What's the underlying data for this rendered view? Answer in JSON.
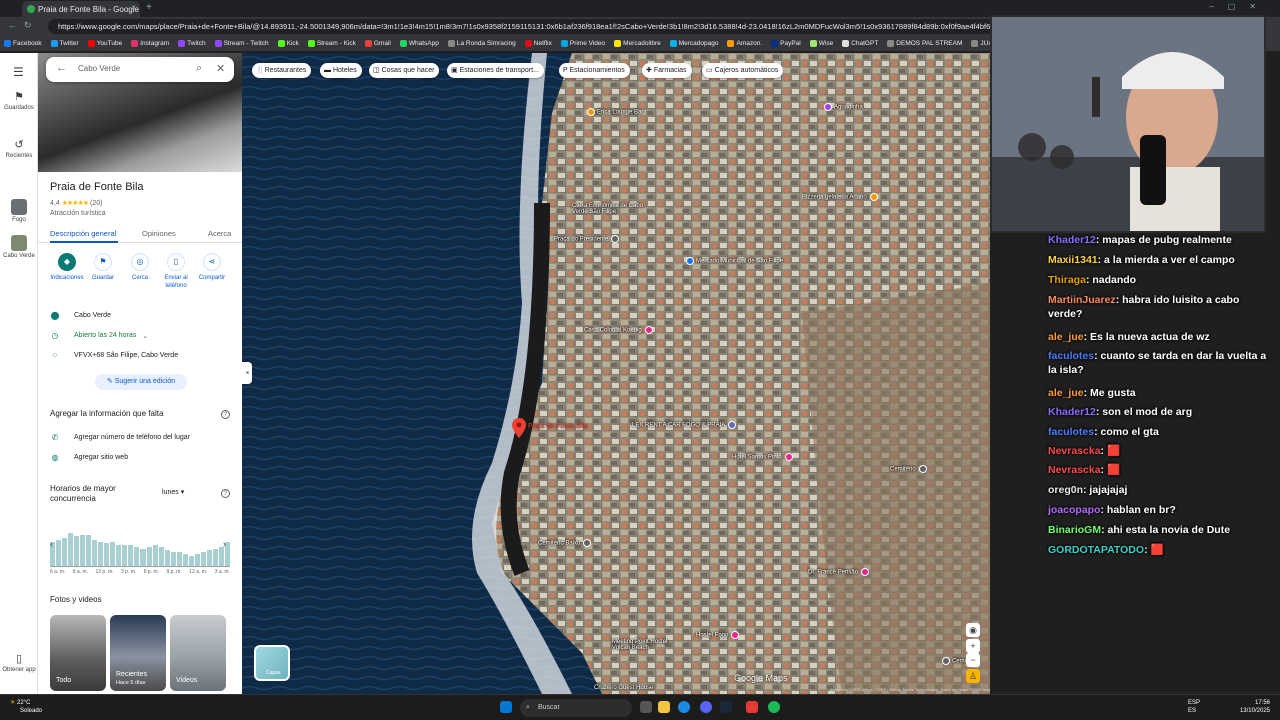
{
  "browser": {
    "tab_title": "Praia de Fonte Bila - Google Map",
    "url": "https://www.google.com/maps/place/Praia+de+Fonte+Bila/@14.893911,-24.5001349,906m/data=!3m1!1e3!4m15!1m8!3m7!1s0x9358f2159115131:0x6b1af236f918ea1f!2sCabo+Verde!3b1!8m2!3d16.5388!4d-23.0418!16zL2m0MDFucWol3m5!1s0x93617889f84d89b:0xf0f9ae4f4bf66acd!8m2!3d14.8931194",
    "bookmarks": [
      {
        "label": "Facebook",
        "color": "#1877f2"
      },
      {
        "label": "Twitter",
        "color": "#1d9bf0"
      },
      {
        "label": "YouTube",
        "color": "#ff0000"
      },
      {
        "label": "Instagram",
        "color": "#e1306c"
      },
      {
        "label": "Twitch",
        "color": "#9146ff"
      },
      {
        "label": "Stream - Twitch",
        "color": "#9146ff"
      },
      {
        "label": "Kick",
        "color": "#53fc18"
      },
      {
        "label": "Stream - Kick",
        "color": "#53fc18"
      },
      {
        "label": "Gmail",
        "color": "#ea4335"
      },
      {
        "label": "WhatsApp",
        "color": "#25d366"
      },
      {
        "label": "La Ronda Simracing",
        "color": "#888888"
      },
      {
        "label": "Netflix",
        "color": "#e50914"
      },
      {
        "label": "Prime Video",
        "color": "#00a8e1"
      },
      {
        "label": "Mercadolibre",
        "color": "#ffe600"
      },
      {
        "label": "Mercadopago",
        "color": "#00b1ea"
      },
      {
        "label": "Amazon.",
        "color": "#ff9900"
      },
      {
        "label": "PayPal",
        "color": "#003087"
      },
      {
        "label": "Wise",
        "color": "#9fe870"
      },
      {
        "label": "ChatGPT",
        "color": "#dddddd"
      },
      {
        "label": "DEMOS PAL STREAM",
        "color": "#888888"
      },
      {
        "label": "JUAN TURRITO",
        "color": "#888888"
      }
    ]
  },
  "rail": {
    "saved": "Guardados",
    "recent": "Recientes",
    "fogo": "Fogo",
    "cabo_verde": "Cabo Verde",
    "get_app": "Obtener app"
  },
  "panel": {
    "search_value": "Cabo Verde",
    "title": "Praia de Fonte Bila",
    "rating": "4,4",
    "stars": "★★★★★",
    "review_count": "(20)",
    "category": "Atracción turística",
    "tabs": [
      "Descripción general",
      "Opiniones",
      "Acerca"
    ],
    "actions": [
      "Indicaciones",
      "Guardar",
      "Cerca",
      "Enviar al teléfono",
      "Compartir"
    ],
    "location": "Cabo Verde",
    "hours": "Abierto las 24 horas",
    "plus_code": "VFVX+68 São Filipe, Cabo Verde",
    "suggest_edit": "Sugerir una edición",
    "missing_info_title": "Agregar la información que falta",
    "add_phone": "Agregar número de teléfono del lugar",
    "add_website": "Agregar sitio web",
    "popular_times_title": "Horarios de mayor concurrencia",
    "day": "lunes",
    "bar_values": [
      0.7,
      0.75,
      0.8,
      0.95,
      0.85,
      0.9,
      0.9,
      0.75,
      0.7,
      0.65,
      0.7,
      0.6,
      0.6,
      0.6,
      0.55,
      0.5,
      0.55,
      0.6,
      0.55,
      0.45,
      0.4,
      0.4,
      0.35,
      0.3,
      0.35,
      0.4,
      0.45,
      0.5,
      0.55,
      0.7
    ],
    "bar_labels": [
      "6 a. m.",
      "9 a. m.",
      "12 p. m.",
      "3 p. m.",
      "6 p. m.",
      "9 p. m.",
      "12 a. m.",
      "3 a. m."
    ],
    "photos_title": "Fotos y videos",
    "photos": [
      {
        "label": "Todo",
        "sub": ""
      },
      {
        "label": "Recientes",
        "sub": "Hace 5 días"
      },
      {
        "label": "Videos",
        "sub": ""
      }
    ]
  },
  "map": {
    "chips": [
      "Restaurantes",
      "Hoteles",
      "Cosas que hacer",
      "Estaciones de transport...",
      "Estacionamientos",
      "Farmacias",
      "Cajeros automáticos"
    ],
    "pin_label": "Praia de Fonte Bila",
    "pois": [
      {
        "label": "Erica Lounge Bar"
      },
      {
        "label": "Aguadinha"
      },
      {
        "label": "Caixa Económica de Cabo Verde São Filipe"
      },
      {
        "label": "Praça do Presidente"
      },
      {
        "label": "Mercado Municipal de São Filipe"
      },
      {
        "label": "Casa Colonial Koenig"
      },
      {
        "label": "Pizzeria gelateria Arlano"
      },
      {
        "label": "LEX RENT A CAR FOGO & PRAIA"
      },
      {
        "label": "Hotel Santos Pinto"
      },
      {
        "label": "Cemitério Baixo"
      },
      {
        "label": "Cemitério"
      },
      {
        "label": "Dr. Francê Pensão"
      },
      {
        "label": "Hotel Xaguate"
      },
      {
        "label": "Hostel Fogo"
      },
      {
        "label": "Meeting Point Hostel Vulcan Beach"
      },
      {
        "label": "Cruzeiro Guest House"
      },
      {
        "label": "Cemitério"
      },
      {
        "label": "Ruá do Pensão Las Vegas"
      }
    ],
    "layers_label": "Capas",
    "logo": "Google Maps",
    "attribution": "Imágenes ©2025 Airbus, CNES / Airbus, Maxar Technologies, Datos del mapa ©2025   Argentina   Condiciones   Privacidad   Enviar comentarios sobre el producto   50 m"
  },
  "chat": [
    {
      "user": "Khader12",
      "text": ": mapas de pubg realmente",
      "color": "#8a6bff"
    },
    {
      "user": "Maxii1341",
      "text": ": a la mierda a ver el campo",
      "color": "#ffd23f"
    },
    {
      "user": "Thiraga",
      "text": ": nadando",
      "color": "#e6a100"
    },
    {
      "user": "MartiinJuarez",
      "text": ": habra ido luisito a cabo verde?",
      "color": "#ff8a5c"
    },
    {
      "user": "ale_jue",
      "text": ": Es la nueva actua de wz",
      "color": "#ff9a3c"
    },
    {
      "user": "faculotes",
      "text": ": cuanto se tarda en dar la vuelta a la isla?",
      "color": "#4c7dff"
    },
    {
      "user": "ale_jue",
      "text": ": Me gusta",
      "color": "#ff9a3c"
    },
    {
      "user": "Khader12",
      "text": ": son el mod de arg",
      "color": "#8a6bff"
    },
    {
      "user": "faculotes",
      "text": ": como el gta",
      "color": "#4c7dff"
    },
    {
      "user": "Nevrascka",
      "text": ": 🟥",
      "color": "#ff4b4b"
    },
    {
      "user": "Nevrascka",
      "text": ": 🟥",
      "color": "#ff4b4b"
    },
    {
      "user": "oreg0n",
      "text": ": jajajajaj",
      "color": "#e8e8e8"
    },
    {
      "user": "joacopapo",
      "text": ": hablan en br?",
      "color": "#b36bff"
    },
    {
      "user": "BinarioGM",
      "text": ": ahi esta la novia de Dute",
      "color": "#6bff6b"
    },
    {
      "user": "GORDOTAPATODO",
      "text": ": 🟥",
      "color": "#3ad1c8"
    }
  ],
  "taskbar": {
    "temp": "22°C",
    "weather": "Soleado",
    "search": "Buscar",
    "lang": "ESP",
    "lang_sub": "ES",
    "time": "17:56",
    "date": "13/10/2025"
  },
  "colors": {
    "accent": "#0b57d0",
    "teal": "#0b7a77",
    "pin": "#ea4335"
  }
}
